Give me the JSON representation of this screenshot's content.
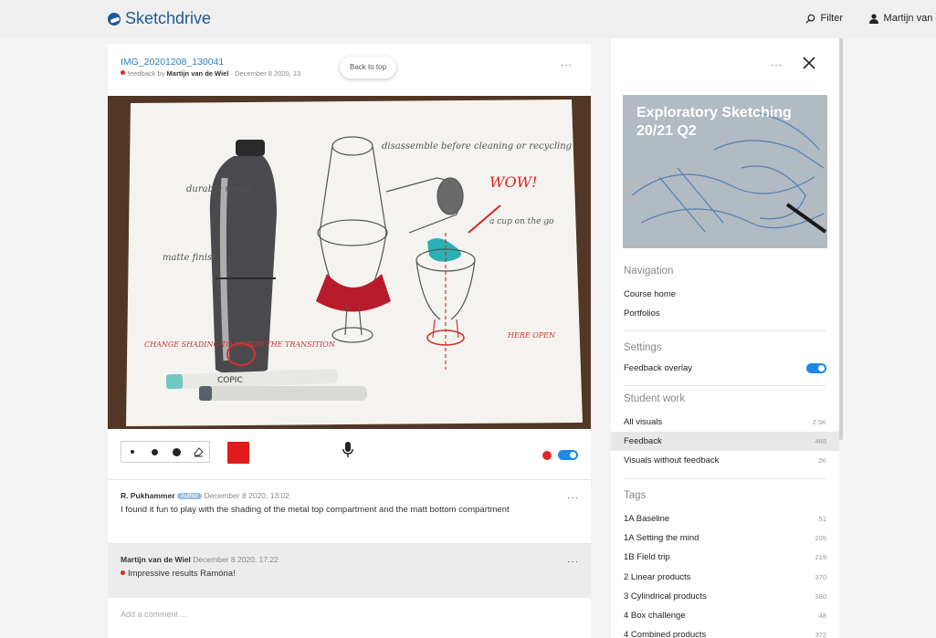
{
  "brand": {
    "name": "Sketchdrive"
  },
  "topbar": {
    "filter_label": "Filter",
    "user_name": "Martijn van de Wiel"
  },
  "post": {
    "title": "IMG_20201208_130041",
    "feedback_by": "feedback by",
    "author": "Martijn van de Wiel",
    "date": "· December 8 2020, 13",
    "back_to_top": "Back to top",
    "menu": "···",
    "image_labels": {
      "disassemble": "disassemble before cleaning or recycling",
      "durable": "durable metal",
      "matte": "matte finish",
      "wow": "WOW!",
      "cup": "a cup on the go",
      "change": "CHANGE SHADING TO MATCH THE TRANSITION",
      "here": "HERE OPEN",
      "copic": "COPIC"
    }
  },
  "toolbar": {
    "brush_sizes": [
      "small",
      "medium",
      "large"
    ],
    "eraser": "eraser-icon",
    "active_color": "#e01b1b",
    "overlay_toggle": true
  },
  "comments": [
    {
      "author": "R. Pukhammer",
      "badge": "Author",
      "date": "December 8 2020, 13:02",
      "text": "I found it fun to play with the shading of the metal top compartment and the matt bottom compartment",
      "menu": "···"
    },
    {
      "author": "Martijn van de Wiel",
      "date": "December 8 2020, 17:22",
      "text": "Impressive results Ramóna!",
      "menu": "···"
    }
  ],
  "add_comment_placeholder": "Add a comment ...",
  "panel": {
    "menu": "···",
    "course_title": "Exploratory Sketching 20/21 Q2",
    "navigation": {
      "title": "Navigation",
      "links": [
        "Course home",
        "Portfolios"
      ]
    },
    "settings": {
      "title": "Settings",
      "feedback_overlay": "Feedback overlay",
      "feedback_overlay_on": true
    },
    "student_work": {
      "title": "Student work",
      "items": [
        {
          "label": "All visuals",
          "count": "2.5K"
        },
        {
          "label": "Feedback",
          "count": "468"
        },
        {
          "label": "Visuals without feedback",
          "count": "2K"
        }
      ]
    },
    "tags": {
      "title": "Tags",
      "items": [
        {
          "label": "1A Baseline",
          "count": "51"
        },
        {
          "label": "1A Setting the mind",
          "count": "205"
        },
        {
          "label": "1B Field trip",
          "count": "219"
        },
        {
          "label": "2 Linear products",
          "count": "370"
        },
        {
          "label": "3 Cylindrical products",
          "count": "380"
        },
        {
          "label": "4 Box challenge",
          "count": "48"
        },
        {
          "label": "4 Combined products",
          "count": "372"
        }
      ]
    }
  }
}
